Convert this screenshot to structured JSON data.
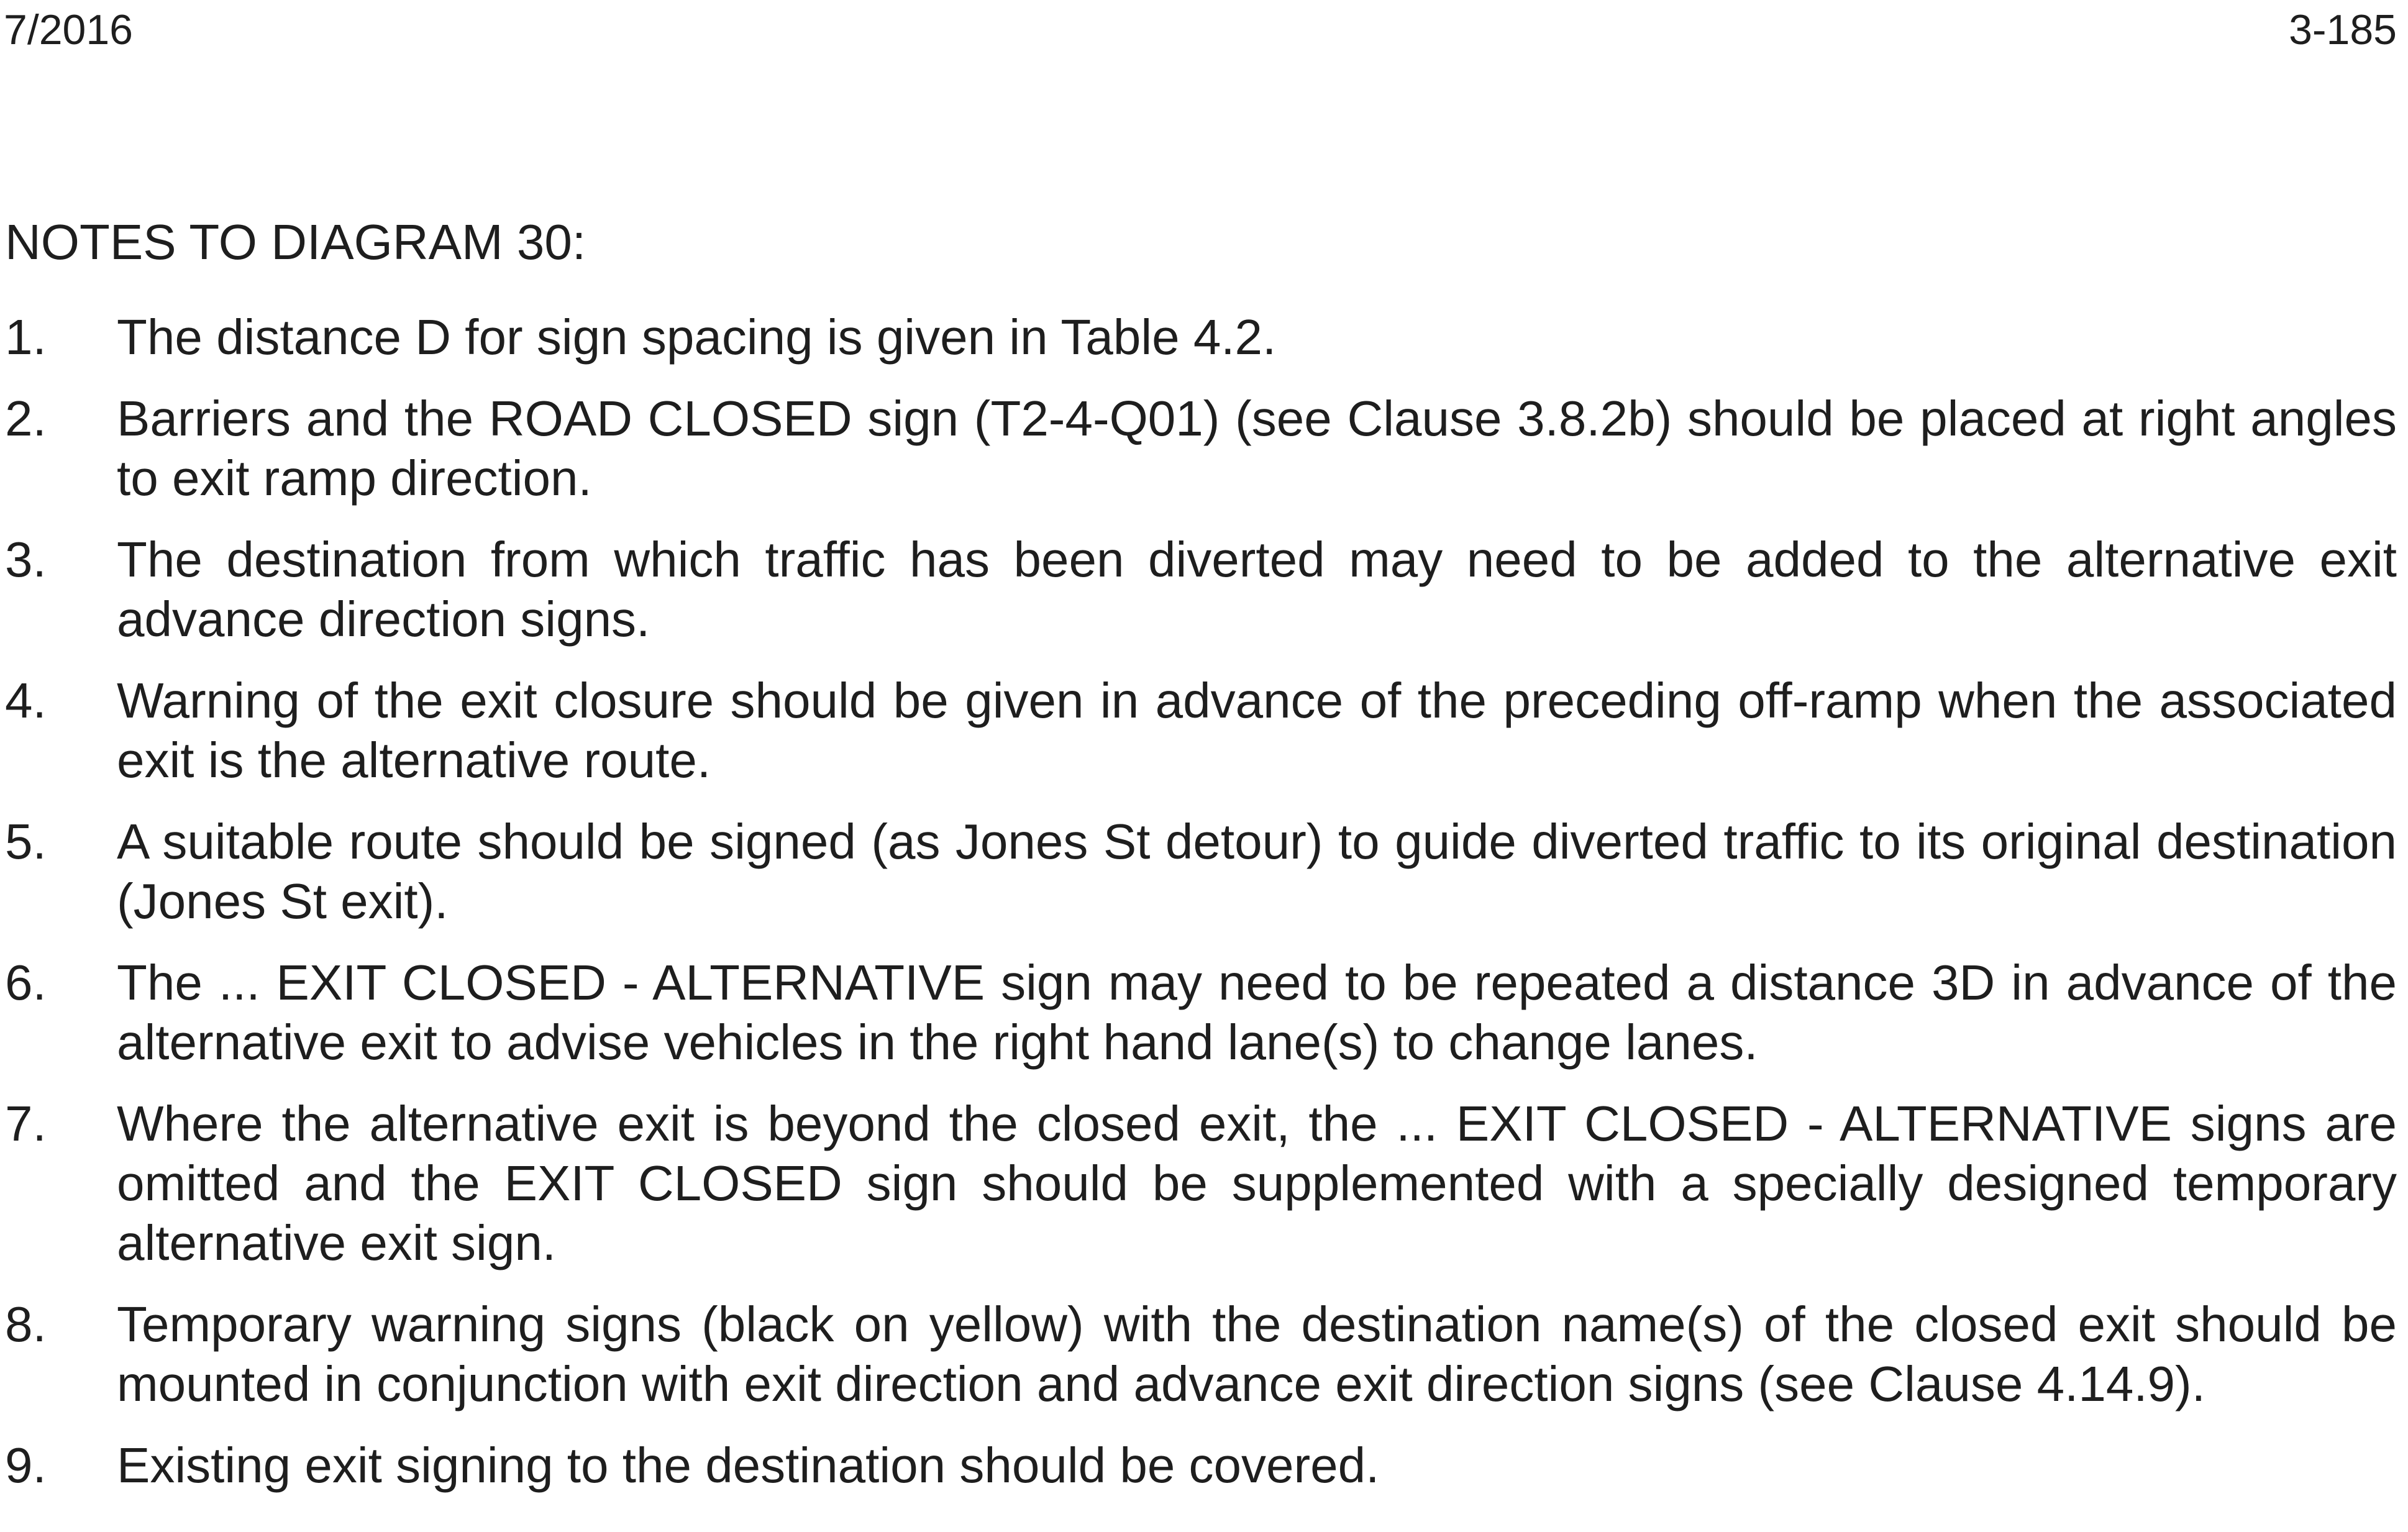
{
  "header": {
    "date": "7/2016",
    "page_number": "3-185"
  },
  "section": {
    "title": "NOTES TO DIAGRAM 30:"
  },
  "notes": [
    {
      "num": "1.",
      "text": "The distance D for sign spacing is given in Table 4.2."
    },
    {
      "num": "2.",
      "text": "Barriers and the ROAD CLOSED sign (T2-4-Q01) (see Clause 3.8.2b) should be placed at right angles to exit ramp direction."
    },
    {
      "num": "3.",
      "text": "The destination from which traffic has been diverted may need to be added to the alternative exit advance direction signs."
    },
    {
      "num": "4.",
      "text": "Warning of the exit closure should be given in advance of the preceding off-ramp when the associated exit is the alternative route."
    },
    {
      "num": "5.",
      "text": "A suitable route should be signed (as Jones St detour) to guide diverted traffic to its original destination (Jones St exit)."
    },
    {
      "num": "6.",
      "text": "The ... EXIT CLOSED - ALTERNATIVE sign may need to be repeated a distance 3D in advance of the alternative exit to advise vehicles in the right hand lane(s) to change lanes."
    },
    {
      "num": "7.",
      "text": "Where the alternative exit is beyond the closed exit, the ... EXIT CLOSED - ALTERNATIVE signs are omitted and the EXIT CLOSED sign should be supplemented with a specially designed temporary alternative exit sign."
    },
    {
      "num": "8.",
      "text": "Temporary warning signs (black on yellow) with the destination name(s) of the closed exit should be mounted in conjunction with exit direction and advance exit direction signs (see Clause 4.14.9)."
    },
    {
      "num": "9.",
      "text": "Existing exit signing to the destination should be covered."
    }
  ]
}
